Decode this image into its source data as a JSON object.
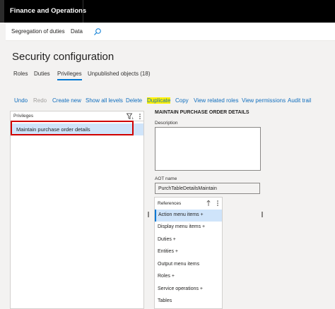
{
  "app": {
    "title": "Finance and Operations"
  },
  "nav": {
    "breadcrumb": [
      "Segregation of duties",
      "Data"
    ]
  },
  "page": {
    "title": "Security configuration"
  },
  "tabs": [
    {
      "label": "Roles",
      "active": false
    },
    {
      "label": "Duties",
      "active": false
    },
    {
      "label": "Privileges",
      "active": true
    },
    {
      "label": "Unpublished objects (18)",
      "active": false
    }
  ],
  "actions": [
    {
      "label": "Undo",
      "enabled": true
    },
    {
      "label": "Redo",
      "enabled": false
    },
    {
      "label": "Create new",
      "enabled": true
    },
    {
      "label": "Show all levels",
      "enabled": true
    },
    {
      "label": "Delete",
      "enabled": true
    },
    {
      "label": "Duplicate",
      "enabled": true,
      "highlighted": true
    },
    {
      "label": "Copy",
      "enabled": true
    },
    {
      "label": "View related roles",
      "enabled": true
    },
    {
      "label": "View permissions",
      "enabled": true
    },
    {
      "label": "Audit trail",
      "enabled": true
    }
  ],
  "privileges": {
    "header": "Privileges",
    "items": [
      {
        "label": "Maintain purchase order details",
        "selected": true
      }
    ]
  },
  "detail": {
    "title": "MAINTAIN PURCHASE ORDER DETAILS",
    "description_label": "Description",
    "description_value": "",
    "aot_label": "AOT name",
    "aot_value": "PurchTableDetailsMaintain"
  },
  "references": {
    "header": "References",
    "items": [
      {
        "label": "Action menu items +",
        "selected": true
      },
      {
        "label": "Display menu items +",
        "selected": false
      },
      {
        "label": "Duties +",
        "selected": false
      },
      {
        "label": "Entities +",
        "selected": false
      },
      {
        "label": "Output menu items",
        "selected": false
      },
      {
        "label": "Roles +",
        "selected": false
      },
      {
        "label": "Service operations +",
        "selected": false
      },
      {
        "label": "Tables",
        "selected": false
      }
    ]
  },
  "colors": {
    "accent": "#0078d4",
    "selection": "#cfe4fa",
    "highlight": "#fff200",
    "callout": "#d00000"
  }
}
